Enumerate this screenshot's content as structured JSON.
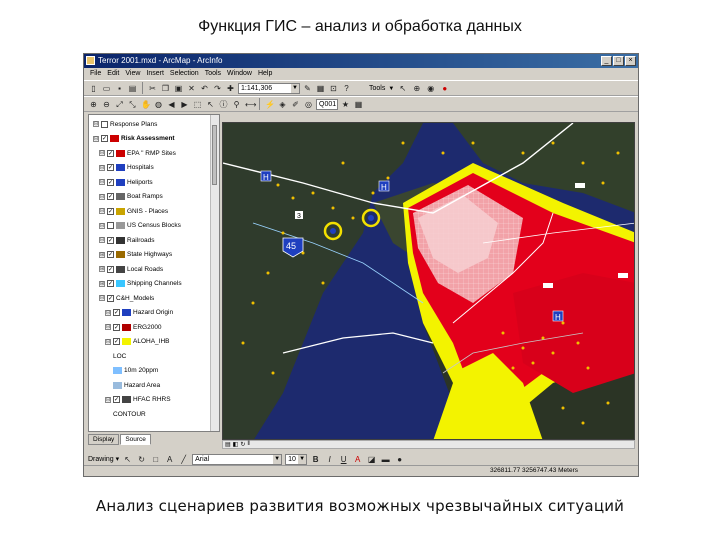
{
  "slide": {
    "title": "Функция ГИС – анализ и обработка данных",
    "caption": "Анализ сценариев развития возможных чрезвычайных ситуаций"
  },
  "window": {
    "title": "Terror 2001.mxd - ArcMap - ArcInfo",
    "menu": [
      "File",
      "Edit",
      "View",
      "Insert",
      "Selection",
      "Tools",
      "Window",
      "Help"
    ],
    "scale": "1:141,306",
    "tools_label": "Tools",
    "editor_value": "Q001"
  },
  "toc": {
    "items": [
      {
        "label": "Response Plans",
        "expander": "⊟",
        "checked": false
      },
      {
        "label": "Risk Assessment",
        "expander": "⊟",
        "checked": true
      },
      {
        "label": "EPA '' RMP Sites",
        "expander": "⊟",
        "checked": true
      },
      {
        "label": "Hospitals",
        "expander": "⊟",
        "checked": true
      },
      {
        "label": "Heliports",
        "expander": "⊟",
        "checked": true
      },
      {
        "label": "Boat Ramps",
        "expander": "⊟",
        "checked": true
      },
      {
        "label": "GNIS - Places",
        "expander": "⊟",
        "checked": true
      },
      {
        "label": "US Census Blocks",
        "expander": "⊟",
        "checked": false
      },
      {
        "label": "Railroads",
        "expander": "⊟",
        "checked": true
      },
      {
        "label": "State Highways",
        "expander": "⊞",
        "checked": true
      },
      {
        "label": "Local Roads",
        "expander": "⊞",
        "checked": true
      },
      {
        "label": "Shipping Channels",
        "expander": "⊞",
        "checked": true
      },
      {
        "label": "C&H_Models",
        "expander": "⊟",
        "checked": true
      },
      {
        "label": "Hazard Origin",
        "expander": "⊟",
        "checked": true
      },
      {
        "label": "ERG2000",
        "expander": "⊟",
        "checked": true
      },
      {
        "label": "ALOHA_IHB",
        "expander": "⊟",
        "checked": true
      },
      {
        "label": "LOC",
        "expander": "",
        "checked": false
      },
      {
        "label": "10m 20ppm",
        "expander": "",
        "checked": false
      },
      {
        "label": "Hazard Area",
        "expander": "",
        "checked": false
      },
      {
        "label": "HFAC RHRS",
        "expander": "⊟",
        "checked": true
      },
      {
        "label": "CONTOUR",
        "expander": "",
        "checked": false
      }
    ],
    "tabs": [
      "Display",
      "Source"
    ]
  },
  "map": {
    "labels": {
      "interstate": "45",
      "route": "3"
    }
  },
  "drawbar": {
    "drawing_label": "Drawing ▾",
    "font": "Arial",
    "size": "10",
    "bold": "B",
    "italic": "I",
    "underline": "U"
  },
  "status": {
    "coords": "326811.77  3256747.43 Meters"
  },
  "colors": {
    "plume_red": "#e3001b",
    "plume_yellow": "#f3f300",
    "water": "#1d2a6e",
    "land": "#2d3a2a"
  }
}
